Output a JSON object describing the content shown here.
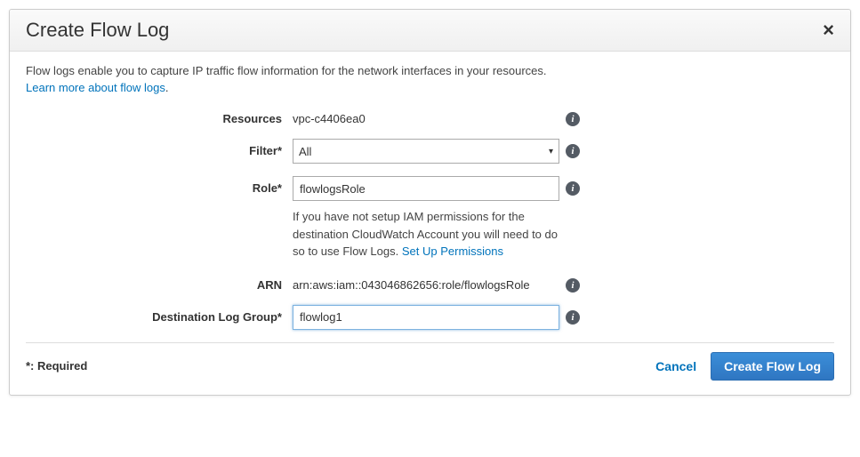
{
  "dialog": {
    "title": "Create Flow Log",
    "close_label": "×",
    "description": "Flow logs enable you to capture IP traffic flow information for the network interfaces in your resources.",
    "learn_more": "Learn more about flow logs",
    "learn_more_suffix": "."
  },
  "form": {
    "resources": {
      "label": "Resources",
      "value": "vpc-c4406ea0"
    },
    "filter": {
      "label": "Filter*",
      "selected": "All"
    },
    "role": {
      "label": "Role*",
      "value": "flowlogsRole",
      "hint_pre": "If you have not setup IAM permissions for the destination CloudWatch Account you will need to do so to use Flow Logs.",
      "hint_link": "Set Up Permissions"
    },
    "arn": {
      "label": "ARN",
      "value": "arn:aws:iam::043046862656:role/flowlogsRole"
    },
    "dest_log": {
      "label": "Destination Log Group*",
      "value": "flowlog1"
    }
  },
  "footer": {
    "required": "*: Required",
    "cancel": "Cancel",
    "submit": "Create Flow Log"
  },
  "icons": {
    "info_glyph": "i"
  }
}
